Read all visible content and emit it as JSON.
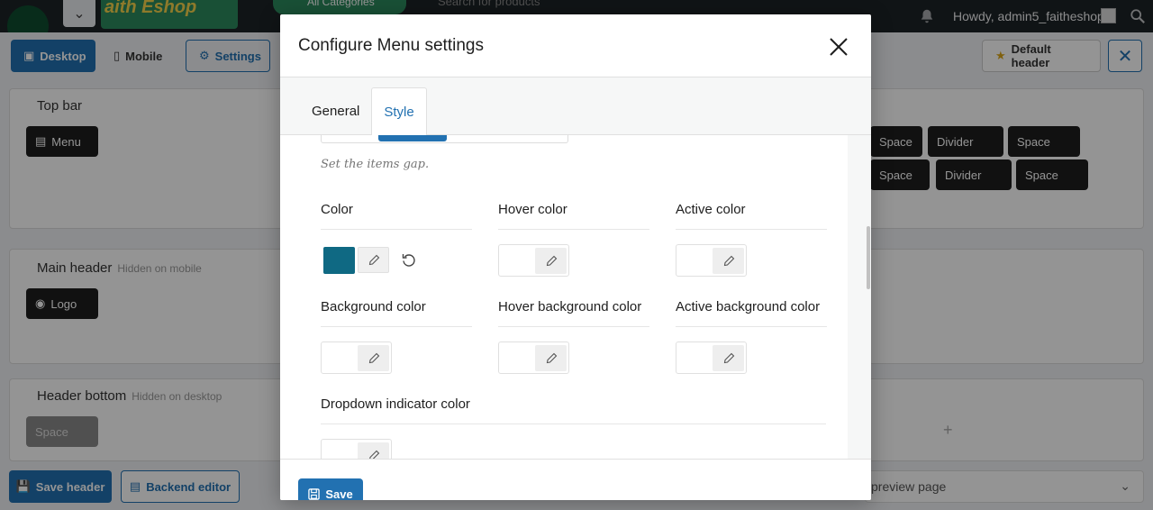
{
  "background": {
    "adminbar": {
      "brand_text": "aith Eshop",
      "all_categories": "All Categories",
      "search_placeholder": "Search for products",
      "howdy": "Howdy, admin5_faitheshop"
    },
    "toolbar": {
      "desktop": "Desktop",
      "mobile": "Mobile",
      "settings": "Settings",
      "default_header": "Default header"
    },
    "sections": {
      "top_bar": {
        "title": "Top bar",
        "chip_menu": "Menu"
      },
      "main_header": {
        "title": "Main header",
        "sub": "Hidden on mobile",
        "chip_logo": "Logo"
      },
      "header_bottom": {
        "title": "Header bottom",
        "sub": "Hidden on desktop",
        "chip_space": "Space"
      },
      "right_row1": [
        "Space",
        "Divider",
        "Space"
      ],
      "right_row2": [
        "Space",
        "Divider",
        "Space"
      ],
      "plus": "+"
    },
    "bottombar": {
      "save_header": "Save header",
      "backend_editor": "Backend editor",
      "preview": "preview page"
    }
  },
  "modal": {
    "title": "Configure Menu settings",
    "tabs": {
      "general": "General",
      "style": "Style"
    },
    "gap_hint": "Set the items gap.",
    "fields": {
      "color": {
        "label": "Color",
        "value": "#0f6983"
      },
      "hover_color": {
        "label": "Hover color"
      },
      "active_color": {
        "label": "Active color"
      },
      "background_color": {
        "label": "Background color"
      },
      "hover_background_color": {
        "label": "Hover background color"
      },
      "active_background_color": {
        "label": "Active background color"
      },
      "dropdown_indicator_color": {
        "label": "Dropdown indicator color"
      }
    },
    "save": "Save"
  },
  "colors": {
    "primary": "#2271b1",
    "selected_color_swatch": "#0f6983"
  }
}
